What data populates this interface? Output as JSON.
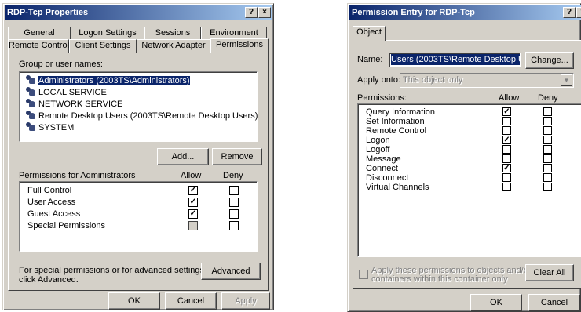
{
  "left": {
    "title": "RDP-Tcp Properties",
    "title_buttons": [
      "?",
      "×"
    ],
    "tabs_back": [
      "General",
      "Logon Settings",
      "Sessions",
      "Environment"
    ],
    "tabs_front": [
      "Remote Control",
      "Client Settings",
      "Network Adapter",
      "Permissions"
    ],
    "group_label": "Group or user names:",
    "groups": [
      {
        "name": "Administrators (2003TS\\Administrators)",
        "selected": true
      },
      {
        "name": "LOCAL SERVICE",
        "selected": false
      },
      {
        "name": "NETWORK SERVICE",
        "selected": false
      },
      {
        "name": "Remote Desktop Users (2003TS\\Remote Desktop Users)",
        "selected": false
      },
      {
        "name": "SYSTEM",
        "selected": false
      }
    ],
    "add_label": "Add...",
    "remove_label": "Remove",
    "perms_label": "Permissions for Administrators",
    "allow_label": "Allow",
    "deny_label": "Deny",
    "permissions": [
      {
        "name": "Full Control",
        "allow": true,
        "deny": false,
        "allow_grey": false
      },
      {
        "name": "User Access",
        "allow": true,
        "deny": false,
        "allow_grey": false
      },
      {
        "name": "Guest Access",
        "allow": true,
        "deny": false,
        "allow_grey": false
      },
      {
        "name": "Special Permissions",
        "allow": false,
        "deny": false,
        "allow_grey": true
      }
    ],
    "special_text_1": "For special permissions or for advanced settings,",
    "special_text_2": "click Advanced.",
    "advanced_label": "Advanced",
    "ok_label": "OK",
    "cancel_label": "Cancel",
    "apply_label": "Apply"
  },
  "right": {
    "title": "Permission Entry for RDP-Tcp",
    "title_buttons": [
      "?",
      "×"
    ],
    "tab": "Object",
    "name_label": "Name:",
    "name_value": "Users (2003TS\\Remote Desktop Users",
    "change_label": "Change...",
    "apply_onto_label": "Apply onto:",
    "apply_onto_value": "This object only",
    "permissions_label": "Permissions:",
    "allow_label": "Allow",
    "deny_label": "Deny",
    "permissions": [
      {
        "name": "Query Information",
        "allow": true,
        "deny": false
      },
      {
        "name": "Set Information",
        "allow": false,
        "deny": false
      },
      {
        "name": "Remote Control",
        "allow": false,
        "deny": false
      },
      {
        "name": "Logon",
        "allow": true,
        "deny": false
      },
      {
        "name": "Logoff",
        "allow": false,
        "deny": false
      },
      {
        "name": "Message",
        "allow": false,
        "deny": false
      },
      {
        "name": "Connect",
        "allow": true,
        "deny": false
      },
      {
        "name": "Disconnect",
        "allow": false,
        "deny": false
      },
      {
        "name": "Virtual Channels",
        "allow": false,
        "deny": false
      }
    ],
    "apply_container_text_1": "Apply these permissions to objects and/or",
    "apply_container_text_2": "containers within this container only",
    "clear_all_label": "Clear All",
    "ok_label": "OK",
    "cancel_label": "Cancel"
  },
  "colors": {
    "face": "#d4d0c8",
    "title_start": "#0a246a",
    "title_end": "#a6caf0",
    "selection": "#0a246a"
  }
}
